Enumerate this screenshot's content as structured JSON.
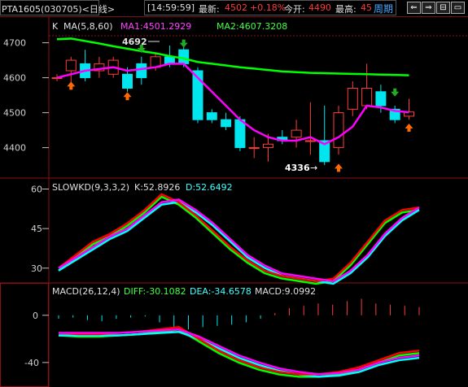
{
  "header": {
    "symbol": "PTA1605",
    "code": "(030705)",
    "period_label": "<日线>",
    "time": "[14:59:59]",
    "latest_label": "最新:",
    "latest_value": "4502",
    "change_pct": "+0.18%",
    "open_label": "今开:",
    "open_value": "4490",
    "high_label": "最高:",
    "high_value": "45",
    "period_button": "周期",
    "buttons": [
      "⇐",
      "⇒",
      "⊟",
      "▭"
    ]
  },
  "colors": {
    "up": "#ff3b3b",
    "down": "#00e5ee",
    "ma1": "#ff00ff",
    "ma2": "#00ff00",
    "k_line": "#ff0000",
    "d_line": "#ff00ff",
    "k_line2": "#00ff00",
    "d_line2": "#00ffff",
    "grid_red": "#8b1010",
    "axis_text": "#d0d0d0"
  },
  "main_panel": {
    "label_k": "K",
    "ma_label": "MA(5,8,60)",
    "ma1_text": "MA1:4501.2929",
    "ma2_text": "MA2:4607.3208",
    "yticks": [
      "4700",
      "4600",
      "4500",
      "4400"
    ],
    "high_annot": "4692",
    "low_annot": "4336",
    "low_annot_arrow": "→"
  },
  "kd_panel": {
    "title": "SLOWKD(9,3,3,2)",
    "k_text": "K:52.8926",
    "d_text": "D:52.6492",
    "yticks": [
      "60",
      "45",
      "30"
    ]
  },
  "macd_panel": {
    "title": "MACD(26,12,4)",
    "diff_text": "DIFF:-30.1082",
    "dea_text": "DEA:-34.6578",
    "macd_text": "MACD:9.0992",
    "yticks": [
      "0",
      "-40"
    ]
  },
  "chart_data": {
    "type": "candlestick",
    "candles": [
      {
        "o": 4600,
        "c": 4600,
        "h": 4610,
        "l": 4590
      },
      {
        "o": 4620,
        "c": 4650,
        "h": 4660,
        "l": 4580
      },
      {
        "o": 4640,
        "c": 4600,
        "h": 4680,
        "l": 4590
      },
      {
        "o": 4620,
        "c": 4640,
        "h": 4660,
        "l": 4600
      },
      {
        "o": 4610,
        "c": 4650,
        "h": 4660,
        "l": 4600
      },
      {
        "o": 4610,
        "c": 4570,
        "h": 4630,
        "l": 4560
      },
      {
        "o": 4640,
        "c": 4600,
        "h": 4660,
        "l": 4580
      },
      {
        "o": 4630,
        "c": 4660,
        "h": 4670,
        "l": 4620
      },
      {
        "o": 4660,
        "c": 4640,
        "h": 4692,
        "l": 4630
      },
      {
        "o": 4680,
        "c": 4640,
        "h": 4690,
        "l": 4630
      },
      {
        "o": 4620,
        "c": 4480,
        "h": 4630,
        "l": 4470
      },
      {
        "o": 4500,
        "c": 4480,
        "h": 4510,
        "l": 4470
      },
      {
        "o": 4480,
        "c": 4460,
        "h": 4500,
        "l": 4450
      },
      {
        "o": 4480,
        "c": 4400,
        "h": 4490,
        "l": 4390
      },
      {
        "o": 4400,
        "c": 4400,
        "h": 4430,
        "l": 4370
      },
      {
        "o": 4400,
        "c": 4410,
        "h": 4440,
        "l": 4360
      },
      {
        "o": 4430,
        "c": 4420,
        "h": 4450,
        "l": 4410
      },
      {
        "o": 4430,
        "c": 4450,
        "h": 4480,
        "l": 4400
      },
      {
        "o": 4420,
        "c": 4420,
        "h": 4530,
        "l": 4380
      },
      {
        "o": 4420,
        "c": 4360,
        "h": 4520,
        "l": 4350
      },
      {
        "o": 4400,
        "c": 4500,
        "h": 4520,
        "l": 4380
      },
      {
        "o": 4510,
        "c": 4570,
        "h": 4590,
        "l": 4490
      },
      {
        "o": 4520,
        "c": 4570,
        "h": 4640,
        "l": 4510
      },
      {
        "o": 4560,
        "c": 4520,
        "h": 4580,
        "l": 4500
      },
      {
        "o": 4510,
        "c": 4480,
        "h": 4520,
        "l": 4470
      },
      {
        "o": 4490,
        "c": 4502,
        "h": 4540,
        "l": 4480
      }
    ],
    "ma1": [
      4600,
      4610,
      4620,
      4625,
      4630,
      4620,
      4625,
      4630,
      4640,
      4640,
      4600,
      4560,
      4520,
      4480,
      4450,
      4430,
      4420,
      4420,
      4430,
      4410,
      4430,
      4460,
      4520,
      4515,
      4505,
      4501
    ],
    "ma2": [
      4710,
      4712,
      4705,
      4698,
      4690,
      4683,
      4676,
      4670,
      4662,
      4655,
      4645,
      4640,
      4635,
      4630,
      4626,
      4622,
      4618,
      4616,
      4614,
      4613,
      4612,
      4611,
      4610,
      4609,
      4608,
      4607
    ],
    "kd": {
      "k": [
        30,
        35,
        40,
        43,
        47,
        52,
        58,
        55,
        50,
        44,
        38,
        33,
        29,
        27,
        26,
        25,
        26,
        32,
        40,
        48,
        52,
        53
      ],
      "d": [
        30,
        34,
        38,
        42,
        45,
        50,
        55,
        56,
        52,
        47,
        41,
        35,
        31,
        28,
        27,
        26,
        25,
        29,
        35,
        43,
        49,
        53
      ],
      "ylim": [
        25,
        62
      ]
    },
    "macd": {
      "diff": [
        -15,
        -16,
        -16,
        -15,
        -14,
        -12,
        -10,
        -20,
        -30,
        -38,
        -44,
        -48,
        -50,
        -50,
        -48,
        -44,
        -38,
        -32,
        -30
      ],
      "dea": [
        -15,
        -15,
        -15,
        -15,
        -14,
        -13,
        -12,
        -18,
        -26,
        -34,
        -40,
        -45,
        -48,
        -50,
        -49,
        -46,
        -40,
        -36,
        -34
      ],
      "hist": [
        -3,
        -2,
        -4,
        -5,
        -3,
        -2,
        -1,
        -6,
        -10,
        -12,
        -10,
        -9,
        -8,
        -6,
        -3,
        2,
        6,
        8,
        10,
        9,
        12,
        14,
        10,
        9,
        8,
        7
      ],
      "ylim": [
        -58,
        15
      ]
    }
  }
}
